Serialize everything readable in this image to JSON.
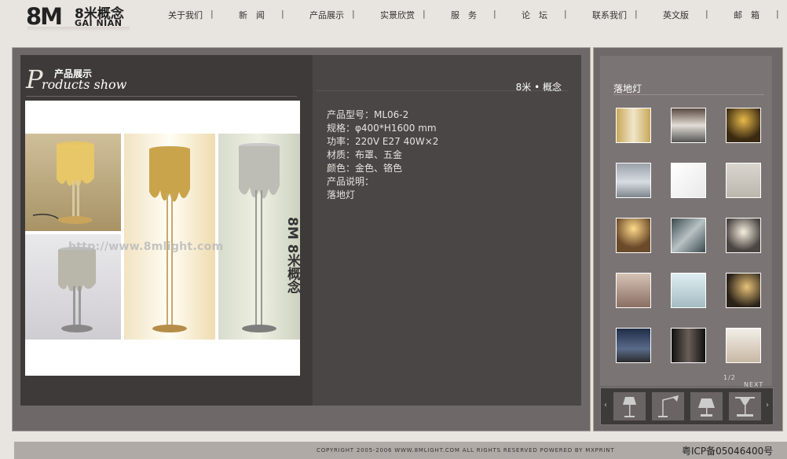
{
  "logo": {
    "big": "8M",
    "cn": "8米概念",
    "pinyin": "GAI NIAN"
  },
  "nav": [
    {
      "label": "关于我们",
      "sep": "|"
    },
    {
      "label": "新　闻",
      "sep": "|"
    },
    {
      "label": "产品展示",
      "sep": "|"
    },
    {
      "label": "实景欣赏",
      "sep": "|"
    },
    {
      "label": "服　务",
      "sep": "|"
    },
    {
      "label": "论　坛",
      "sep": "|"
    },
    {
      "label": "联系我们",
      "sep": "|"
    },
    {
      "label": "英文版",
      "sep": "|"
    },
    {
      "label": "邮　箱",
      "sep": "|"
    }
  ],
  "section": {
    "big_letter": "P",
    "title_cn": "产品展示",
    "title_en": "roducts show"
  },
  "photo": {
    "watermark": "http://www.8mlight.com",
    "vertical_logo": "8M 8米概念"
  },
  "brand": "8米 • 概念",
  "specs": [
    "产品型号：ML06-2",
    "规格：φ400*H1600 mm",
    "功率：220V E27 40W×2",
    "材质：布罩、五金",
    "颜色：金色、铬色",
    "产品说明：",
    "落地灯"
  ],
  "sidebar": {
    "title": "落地灯",
    "pager": {
      "page": "1/2",
      "next": "NEXT"
    },
    "carousel": {
      "left": "‹",
      "right": "›"
    }
  },
  "footer": {
    "copyright": "COPYRIGHT 2005-2006 WWW.8MLIGHT.COM ALL RIGHTS RESERVED POWERED BY MXPRINT",
    "icp": "粤ICP备05046400号"
  }
}
